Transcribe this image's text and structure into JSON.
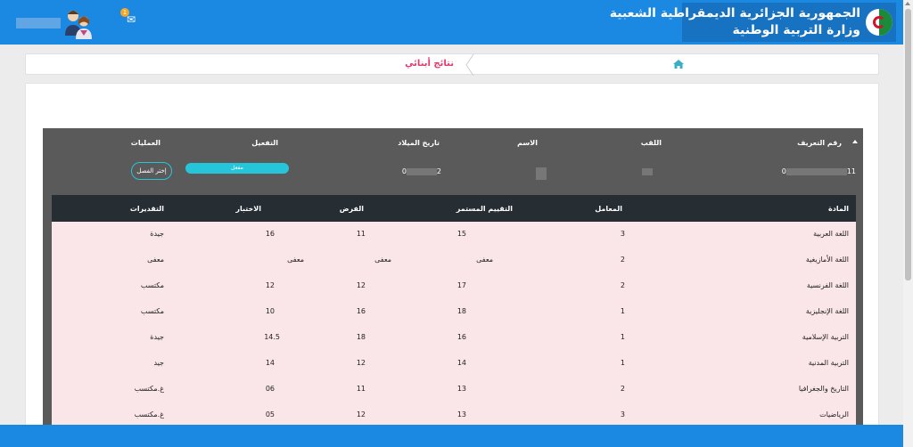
{
  "header": {
    "title_line1": "الجمهورية الجزائرية الديمقراطية الشعبية",
    "title_line2": "وزارة التربية الوطنية",
    "notification_count": "1",
    "colors": {
      "bar": "#1b88e2",
      "brand_bg": "#1773c2",
      "accent": "#e5396d"
    }
  },
  "breadcrumb": {
    "active": "نتائج أبنائي"
  },
  "student": {
    "headers": {
      "id": "رقم التعريف",
      "surname": "اللقب",
      "name": "الاسم",
      "birthdate": "تاريخ الميلاد",
      "activation": "التفعيل",
      "operations": "العمليات"
    },
    "id_prefix": "11",
    "id_suffix": "0",
    "birth_prefix": "2",
    "birth_suffix": "0",
    "activation_label": "مفعل",
    "close_label": "إختر الفصل"
  },
  "grades": {
    "headers": {
      "subject": "المادة",
      "coef": "المعامل",
      "continuous": "التقييم المستمر",
      "homework": "الفرض",
      "exam": "الاختبار",
      "appreciation": "التقديرات"
    },
    "rows": [
      {
        "subject": "اللغة العربية",
        "coef": "3",
        "continuous": "15",
        "homework": "11",
        "exam": "16",
        "appreciation": "جيدة"
      },
      {
        "subject": "اللغة الأمازيغية",
        "coef": "2",
        "continuous": "معفى",
        "homework": "معفى",
        "exam": "معفى",
        "appreciation": "معفى"
      },
      {
        "subject": "اللغة الفرنسية",
        "coef": "2",
        "continuous": "17",
        "homework": "12",
        "exam": "12",
        "appreciation": "مكتسب"
      },
      {
        "subject": "اللغة الإنجليزية",
        "coef": "1",
        "continuous": "18",
        "homework": "16",
        "exam": "10",
        "appreciation": "مكتسب"
      },
      {
        "subject": "التربية الإسلامية",
        "coef": "1",
        "continuous": "16",
        "homework": "18",
        "exam": "14.5",
        "appreciation": "جيدة"
      },
      {
        "subject": "التربية المدنية",
        "coef": "1",
        "continuous": "14",
        "homework": "12",
        "exam": "14",
        "appreciation": "جيد"
      },
      {
        "subject": "التاريخ والجغرافيا",
        "coef": "2",
        "continuous": "13",
        "homework": "11",
        "exam": "06",
        "appreciation": "غ.مكتسب"
      },
      {
        "subject": "الرياضيات",
        "coef": "3",
        "continuous": "13",
        "homework": "12",
        "exam": "05",
        "appreciation": "غ.مكتسب"
      }
    ]
  }
}
